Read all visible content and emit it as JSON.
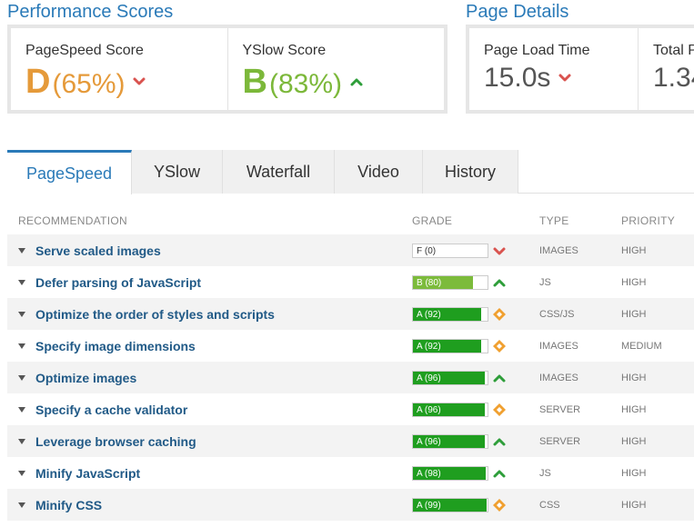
{
  "performance_scores": {
    "title": "Performance Scores",
    "pagespeed": {
      "label": "PageSpeed Score",
      "grade": "D",
      "percent": "(65%)",
      "grade_color": "#e59a3a",
      "trend": "down"
    },
    "yslow": {
      "label": "YSlow Score",
      "grade": "B",
      "percent": "(83%)",
      "grade_color": "#7cb83a",
      "trend": "up"
    }
  },
  "page_details": {
    "title": "Page Details",
    "load_time": {
      "label": "Page Load Time",
      "value": "15.0s",
      "trend": "down"
    },
    "total": {
      "label": "Total P",
      "value": "1.34"
    }
  },
  "tabs": [
    {
      "label": "PageSpeed",
      "active": true
    },
    {
      "label": "YSlow",
      "active": false
    },
    {
      "label": "Waterfall",
      "active": false
    },
    {
      "label": "Video",
      "active": false
    },
    {
      "label": "History",
      "active": false
    }
  ],
  "table": {
    "headers": {
      "recommendation": "RECOMMENDATION",
      "grade": "GRADE",
      "type": "TYPE",
      "priority": "PRIORITY"
    },
    "rows": [
      {
        "name": "Serve scaled images",
        "grade_label": "F (0)",
        "score": 0,
        "fill": "#ffffff",
        "status": "down",
        "type": "IMAGES",
        "priority": "HIGH"
      },
      {
        "name": "Defer parsing of JavaScript",
        "grade_label": "B (80)",
        "score": 80,
        "fill": "#7cbb3b",
        "status": "up",
        "type": "JS",
        "priority": "HIGH"
      },
      {
        "name": "Optimize the order of styles and scripts",
        "grade_label": "A (92)",
        "score": 92,
        "fill": "#1f9e1f",
        "status": "neutral",
        "type": "CSS/JS",
        "priority": "HIGH"
      },
      {
        "name": "Specify image dimensions",
        "grade_label": "A (92)",
        "score": 92,
        "fill": "#1f9e1f",
        "status": "neutral",
        "type": "IMAGES",
        "priority": "MEDIUM"
      },
      {
        "name": "Optimize images",
        "grade_label": "A (96)",
        "score": 96,
        "fill": "#1f9e1f",
        "status": "up",
        "type": "IMAGES",
        "priority": "HIGH"
      },
      {
        "name": "Specify a cache validator",
        "grade_label": "A (96)",
        "score": 96,
        "fill": "#1f9e1f",
        "status": "neutral",
        "type": "SERVER",
        "priority": "HIGH"
      },
      {
        "name": "Leverage browser caching",
        "grade_label": "A (96)",
        "score": 96,
        "fill": "#1f9e1f",
        "status": "up",
        "type": "SERVER",
        "priority": "HIGH"
      },
      {
        "name": "Minify JavaScript",
        "grade_label": "A (98)",
        "score": 98,
        "fill": "#1f9e1f",
        "status": "up",
        "type": "JS",
        "priority": "HIGH"
      },
      {
        "name": "Minify CSS",
        "grade_label": "A (99)",
        "score": 99,
        "fill": "#1f9e1f",
        "status": "neutral",
        "type": "CSS",
        "priority": "HIGH"
      }
    ]
  }
}
